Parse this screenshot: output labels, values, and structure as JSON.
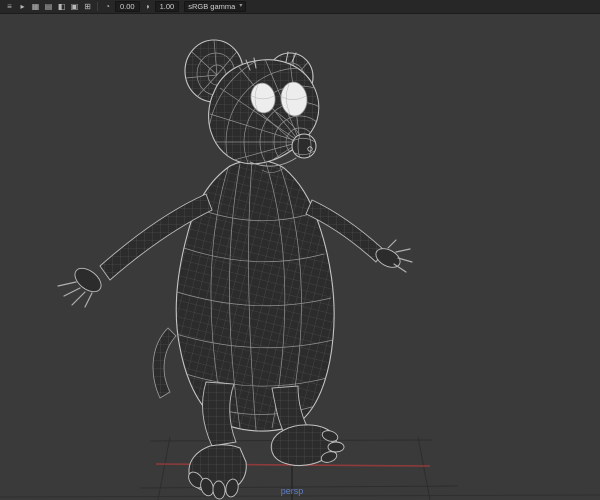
{
  "toolbar": {
    "left_icons": [
      {
        "name": "menu-grip",
        "glyph": "≡"
      },
      {
        "name": "play",
        "glyph": "▸"
      },
      {
        "name": "grid-view",
        "glyph": "▦"
      },
      {
        "name": "list-view",
        "glyph": "▤"
      },
      {
        "name": "split-view",
        "glyph": "◧"
      },
      {
        "name": "active-panel",
        "glyph": "▣"
      },
      {
        "name": "add-panel",
        "glyph": "⊞"
      }
    ],
    "exposure_icon": "◔",
    "exposure_value": "0.00",
    "gamma_icon": "◑",
    "gamma_value": "1.00",
    "colorspace_label": "sRGB gamma",
    "dropdown_arrow": "▾"
  },
  "viewport": {
    "camera_label": "persp"
  },
  "colors": {
    "toolbar_bg": "#272727",
    "viewport_bg": "#3a3a3a",
    "field_bg": "#1d1d1d",
    "icon_color": "#b9b9b9",
    "text_color": "#cfcfcf",
    "wireframe": "#b4b4b4",
    "model_fill": "#2c2c2c",
    "eye_white": "#ededed",
    "axis_red": "#8e3a3a",
    "grid_line": "#2d2d2d",
    "label_blue": "#5f7ec9"
  }
}
